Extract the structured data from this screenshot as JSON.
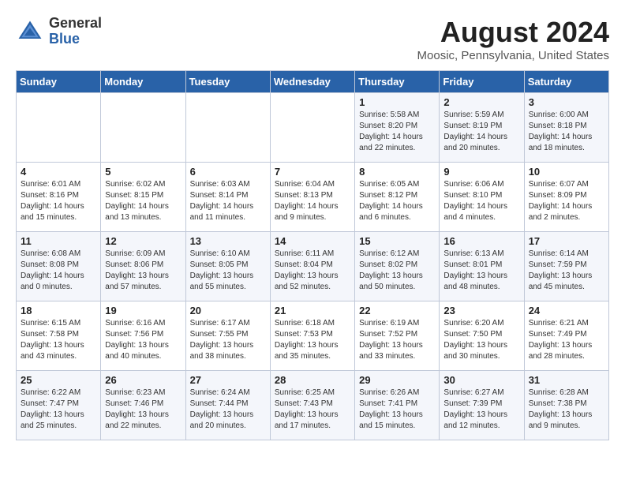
{
  "header": {
    "logo_line1": "General",
    "logo_line2": "Blue",
    "month_title": "August 2024",
    "location": "Moosic, Pennsylvania, United States"
  },
  "days_of_week": [
    "Sunday",
    "Monday",
    "Tuesday",
    "Wednesday",
    "Thursday",
    "Friday",
    "Saturday"
  ],
  "weeks": [
    [
      {
        "day": "",
        "text": ""
      },
      {
        "day": "",
        "text": ""
      },
      {
        "day": "",
        "text": ""
      },
      {
        "day": "",
        "text": ""
      },
      {
        "day": "1",
        "text": "Sunrise: 5:58 AM\nSunset: 8:20 PM\nDaylight: 14 hours and 22 minutes."
      },
      {
        "day": "2",
        "text": "Sunrise: 5:59 AM\nSunset: 8:19 PM\nDaylight: 14 hours and 20 minutes."
      },
      {
        "day": "3",
        "text": "Sunrise: 6:00 AM\nSunset: 8:18 PM\nDaylight: 14 hours and 18 minutes."
      }
    ],
    [
      {
        "day": "4",
        "text": "Sunrise: 6:01 AM\nSunset: 8:16 PM\nDaylight: 14 hours and 15 minutes."
      },
      {
        "day": "5",
        "text": "Sunrise: 6:02 AM\nSunset: 8:15 PM\nDaylight: 14 hours and 13 minutes."
      },
      {
        "day": "6",
        "text": "Sunrise: 6:03 AM\nSunset: 8:14 PM\nDaylight: 14 hours and 11 minutes."
      },
      {
        "day": "7",
        "text": "Sunrise: 6:04 AM\nSunset: 8:13 PM\nDaylight: 14 hours and 9 minutes."
      },
      {
        "day": "8",
        "text": "Sunrise: 6:05 AM\nSunset: 8:12 PM\nDaylight: 14 hours and 6 minutes."
      },
      {
        "day": "9",
        "text": "Sunrise: 6:06 AM\nSunset: 8:10 PM\nDaylight: 14 hours and 4 minutes."
      },
      {
        "day": "10",
        "text": "Sunrise: 6:07 AM\nSunset: 8:09 PM\nDaylight: 14 hours and 2 minutes."
      }
    ],
    [
      {
        "day": "11",
        "text": "Sunrise: 6:08 AM\nSunset: 8:08 PM\nDaylight: 14 hours and 0 minutes."
      },
      {
        "day": "12",
        "text": "Sunrise: 6:09 AM\nSunset: 8:06 PM\nDaylight: 13 hours and 57 minutes."
      },
      {
        "day": "13",
        "text": "Sunrise: 6:10 AM\nSunset: 8:05 PM\nDaylight: 13 hours and 55 minutes."
      },
      {
        "day": "14",
        "text": "Sunrise: 6:11 AM\nSunset: 8:04 PM\nDaylight: 13 hours and 52 minutes."
      },
      {
        "day": "15",
        "text": "Sunrise: 6:12 AM\nSunset: 8:02 PM\nDaylight: 13 hours and 50 minutes."
      },
      {
        "day": "16",
        "text": "Sunrise: 6:13 AM\nSunset: 8:01 PM\nDaylight: 13 hours and 48 minutes."
      },
      {
        "day": "17",
        "text": "Sunrise: 6:14 AM\nSunset: 7:59 PM\nDaylight: 13 hours and 45 minutes."
      }
    ],
    [
      {
        "day": "18",
        "text": "Sunrise: 6:15 AM\nSunset: 7:58 PM\nDaylight: 13 hours and 43 minutes."
      },
      {
        "day": "19",
        "text": "Sunrise: 6:16 AM\nSunset: 7:56 PM\nDaylight: 13 hours and 40 minutes."
      },
      {
        "day": "20",
        "text": "Sunrise: 6:17 AM\nSunset: 7:55 PM\nDaylight: 13 hours and 38 minutes."
      },
      {
        "day": "21",
        "text": "Sunrise: 6:18 AM\nSunset: 7:53 PM\nDaylight: 13 hours and 35 minutes."
      },
      {
        "day": "22",
        "text": "Sunrise: 6:19 AM\nSunset: 7:52 PM\nDaylight: 13 hours and 33 minutes."
      },
      {
        "day": "23",
        "text": "Sunrise: 6:20 AM\nSunset: 7:50 PM\nDaylight: 13 hours and 30 minutes."
      },
      {
        "day": "24",
        "text": "Sunrise: 6:21 AM\nSunset: 7:49 PM\nDaylight: 13 hours and 28 minutes."
      }
    ],
    [
      {
        "day": "25",
        "text": "Sunrise: 6:22 AM\nSunset: 7:47 PM\nDaylight: 13 hours and 25 minutes."
      },
      {
        "day": "26",
        "text": "Sunrise: 6:23 AM\nSunset: 7:46 PM\nDaylight: 13 hours and 22 minutes."
      },
      {
        "day": "27",
        "text": "Sunrise: 6:24 AM\nSunset: 7:44 PM\nDaylight: 13 hours and 20 minutes."
      },
      {
        "day": "28",
        "text": "Sunrise: 6:25 AM\nSunset: 7:43 PM\nDaylight: 13 hours and 17 minutes."
      },
      {
        "day": "29",
        "text": "Sunrise: 6:26 AM\nSunset: 7:41 PM\nDaylight: 13 hours and 15 minutes."
      },
      {
        "day": "30",
        "text": "Sunrise: 6:27 AM\nSunset: 7:39 PM\nDaylight: 13 hours and 12 minutes."
      },
      {
        "day": "31",
        "text": "Sunrise: 6:28 AM\nSunset: 7:38 PM\nDaylight: 13 hours and 9 minutes."
      }
    ]
  ]
}
